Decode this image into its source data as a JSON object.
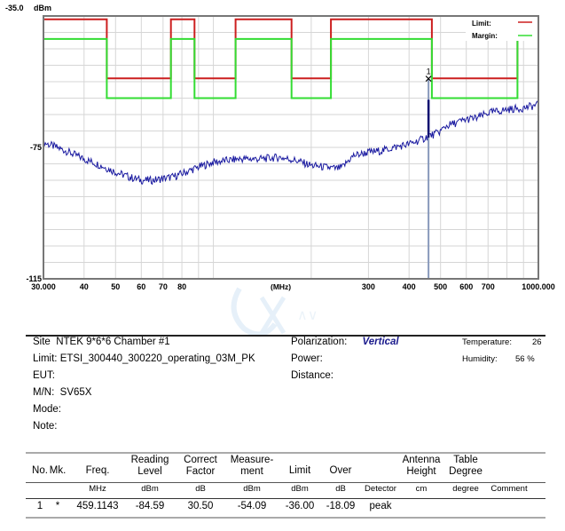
{
  "chart_data": {
    "type": "line",
    "title": "",
    "xlabel": "(MHz)",
    "ylabel": "dBm",
    "xscale": "log",
    "xlim": [
      30,
      1000
    ],
    "ylim": [
      -115,
      -35
    ],
    "y_top_label": "-35.0",
    "y_unit_label": "dBm",
    "y_tick_labels": [
      {
        "value": -75,
        "label": "-75"
      },
      {
        "value": -115,
        "label": "-115"
      }
    ],
    "y_gridlines": [
      -40,
      -45,
      -50,
      -55,
      -60,
      -65,
      -70,
      -75,
      -80,
      -85,
      -90,
      -95,
      -100,
      -105,
      -110
    ],
    "x_tick_labels": [
      {
        "value": 30,
        "label": "30.000"
      },
      {
        "value": 40,
        "label": "40"
      },
      {
        "value": 50,
        "label": "50"
      },
      {
        "value": 60,
        "label": "60"
      },
      {
        "value": 70,
        "label": "70"
      },
      {
        "value": 80,
        "label": "80"
      },
      {
        "value": 300,
        "label": "300"
      },
      {
        "value": 400,
        "label": "400"
      },
      {
        "value": 500,
        "label": "500"
      },
      {
        "value": 600,
        "label": "600"
      },
      {
        "value": 700,
        "label": "700"
      },
      {
        "value": 1000,
        "label": "1000.000"
      }
    ],
    "x_gridlines": [
      40,
      50,
      60,
      70,
      80,
      90,
      100,
      200,
      300,
      400,
      500,
      600,
      700,
      800,
      900
    ],
    "grid": true,
    "legend": {
      "placement": "top-right",
      "entries": [
        {
          "name": "Limit:",
          "color": "#cc1f1f"
        },
        {
          "name": "Margin:",
          "color": "#33dd33"
        }
      ]
    },
    "series": [
      {
        "name": "Limit",
        "color": "#cc1f1f",
        "step": true,
        "points": [
          [
            30,
            -36
          ],
          [
            47,
            -36
          ],
          [
            47,
            -54
          ],
          [
            74,
            -54
          ],
          [
            74,
            -36
          ],
          [
            87.5,
            -36
          ],
          [
            87.5,
            -54
          ],
          [
            117,
            -54
          ],
          [
            117,
            -36
          ],
          [
            174,
            -36
          ],
          [
            174,
            -54
          ],
          [
            230,
            -54
          ],
          [
            230,
            -36
          ],
          [
            470,
            -36
          ],
          [
            470,
            -54
          ],
          [
            862,
            -54
          ],
          [
            862,
            -36
          ],
          [
            1000,
            -36
          ]
        ]
      },
      {
        "name": "Margin",
        "color": "#33dd33",
        "step": true,
        "points": [
          [
            30,
            -42
          ],
          [
            47,
            -42
          ],
          [
            47,
            -60
          ],
          [
            74,
            -60
          ],
          [
            74,
            -42
          ],
          [
            87.5,
            -42
          ],
          [
            87.5,
            -60
          ],
          [
            117,
            -60
          ],
          [
            117,
            -42
          ],
          [
            174,
            -42
          ],
          [
            174,
            -60
          ],
          [
            230,
            -60
          ],
          [
            230,
            -42
          ],
          [
            470,
            -42
          ],
          [
            470,
            -60
          ],
          [
            862,
            -60
          ],
          [
            862,
            -42
          ],
          [
            1000,
            -42
          ]
        ]
      },
      {
        "name": "Measurement trace",
        "color": "#1a1aa0",
        "points": [
          [
            30,
            -73.5
          ],
          [
            35,
            -76
          ],
          [
            40,
            -78.5
          ],
          [
            45,
            -80.5
          ],
          [
            50,
            -82.5
          ],
          [
            55,
            -84
          ],
          [
            60,
            -85
          ],
          [
            65,
            -85
          ],
          [
            70,
            -84.5
          ],
          [
            75,
            -84
          ],
          [
            80,
            -83
          ],
          [
            90,
            -81
          ],
          [
            100,
            -79.5
          ],
          [
            110,
            -79
          ],
          [
            120,
            -78.5
          ],
          [
            140,
            -78.5
          ],
          [
            160,
            -78
          ],
          [
            180,
            -79
          ],
          [
            200,
            -80.5
          ],
          [
            220,
            -81
          ],
          [
            240,
            -81.5
          ],
          [
            250,
            -81
          ],
          [
            260,
            -79
          ],
          [
            270,
            -77.5
          ],
          [
            300,
            -76.5
          ],
          [
            330,
            -76
          ],
          [
            360,
            -75
          ],
          [
            400,
            -74
          ],
          [
            440,
            -72.5
          ],
          [
            459.1,
            -71.5
          ],
          [
            480,
            -71
          ],
          [
            500,
            -70
          ],
          [
            520,
            -68.5
          ],
          [
            560,
            -67.5
          ],
          [
            600,
            -66.5
          ],
          [
            650,
            -66
          ],
          [
            700,
            -64.5
          ],
          [
            750,
            -64
          ],
          [
            800,
            -63.5
          ],
          [
            900,
            -63
          ],
          [
            1000,
            -62
          ]
        ]
      }
    ],
    "marker": {
      "label": "1",
      "freq_mhz": 459.1143,
      "level_dbm": -54.09,
      "spike_base_dbm": -115,
      "spike_mid_dbm": -60.5
    },
    "noise_amplitude_db": 1.2
  },
  "info": {
    "site_label": "Site",
    "site_value": "NTEK 9*6*6 Chamber #1",
    "limit_label": "Limit:",
    "limit_value": "ETSI_300440_300220_operating_03M_PK",
    "eut_label": "EUT:",
    "eut_value": "",
    "mn_label": "M/N:",
    "mn_value": "SV65X",
    "mode_label": "Mode:",
    "mode_value": "",
    "note_label": "Note:",
    "note_value": "",
    "polarization_label": "Polarization:",
    "polarization_value": "Vertical",
    "power_label": "Power:",
    "distance_label": "Distance:",
    "temperature_label": "Temperature:",
    "temperature_value": "26",
    "humidity_label": "Humidity:",
    "humidity_value": "56 %"
  },
  "table": {
    "headers": [
      {
        "line1": "No.",
        "line2": ""
      },
      {
        "line1": "Mk.",
        "line2": ""
      },
      {
        "line1": "Freq.",
        "line2": ""
      },
      {
        "line1": "Reading",
        "line2": "Level"
      },
      {
        "line1": "Correct",
        "line2": "Factor"
      },
      {
        "line1": "Measure-",
        "line2": "ment"
      },
      {
        "line1": "Limit",
        "line2": ""
      },
      {
        "line1": "Over",
        "line2": ""
      },
      {
        "line1": "",
        "line2": ""
      },
      {
        "line1": "Antenna",
        "line2": "Height"
      },
      {
        "line1": "Table",
        "line2": "Degree"
      },
      {
        "line1": "",
        "line2": ""
      }
    ],
    "units": [
      "",
      "",
      "MHz",
      "dBm",
      "dB",
      "dBm",
      "dBm",
      "dB",
      "Detector",
      "cm",
      "degree",
      "Comment"
    ],
    "rows": [
      [
        "1",
        "*",
        "459.1143",
        "-84.59",
        "30.50",
        "-54.09",
        "-36.00",
        "-18.09",
        "peak",
        "",
        "",
        ""
      ]
    ]
  }
}
